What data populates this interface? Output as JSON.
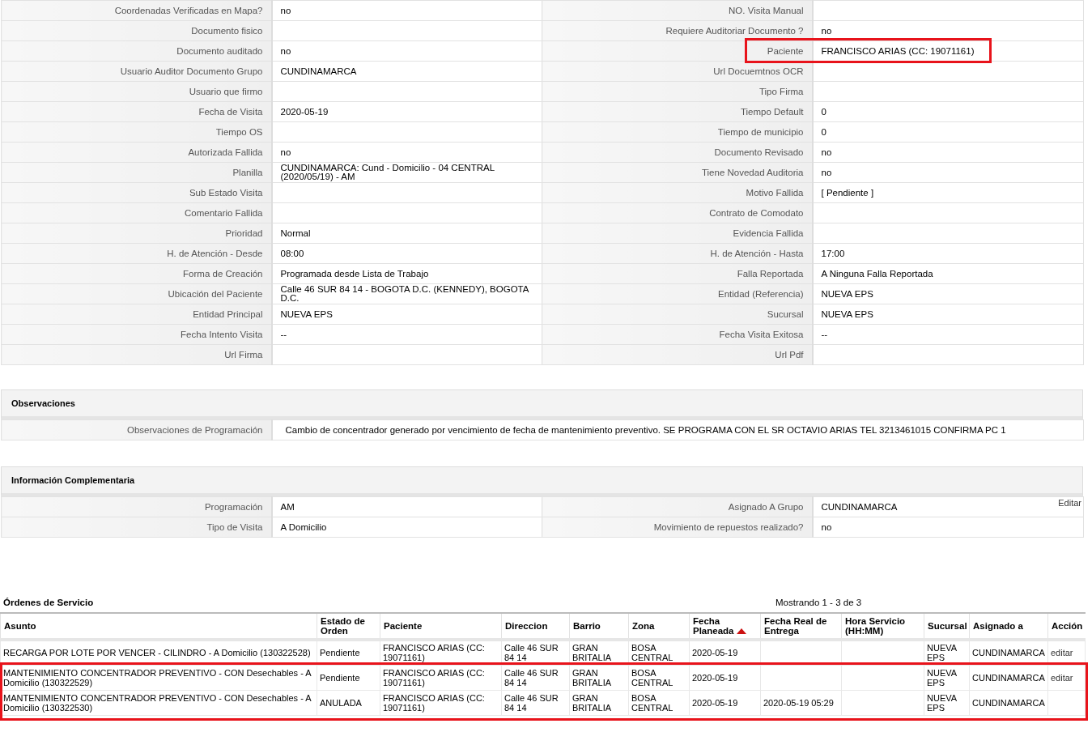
{
  "details": [
    {
      "left": {
        "label": "Coordenadas Verificadas en Mapa?",
        "value": "no"
      },
      "right": {
        "label": "NO. Visita Manual"
      }
    },
    {
      "left": {
        "label": "Documento fisico"
      },
      "right": {
        "label": "Requiere Auditoriar Documento ?",
        "value": "no"
      }
    },
    {
      "left": {
        "label": "Documento auditado",
        "value": "no"
      },
      "right": {
        "label": "Paciente",
        "value": "FRANCISCO ARIAS (CC: 19071161)",
        "highlighted": true
      }
    },
    {
      "left": {
        "label": "Usuario Auditor Documento Grupo",
        "value": "CUNDINAMARCA"
      },
      "right": {
        "label": "Url Docuemtnos OCR"
      }
    },
    {
      "left": {
        "label": "Usuario que firmo"
      },
      "right": {
        "label": "Tipo Firma"
      }
    },
    {
      "left": {
        "label": "Fecha de Visita",
        "value": "2020-05-19"
      },
      "right": {
        "label": "Tiempo Default",
        "value": "0"
      }
    },
    {
      "left": {
        "label": "Tiempo OS"
      },
      "right": {
        "label": "Tiempo de municipio",
        "value": "0"
      }
    },
    {
      "left": {
        "label": "Autorizada Fallida",
        "value": "no"
      },
      "right": {
        "label": "Documento Revisado",
        "value": "no"
      }
    },
    {
      "left": {
        "label": "Planilla",
        "value": "CUNDINAMARCA: Cund - Domicilio - 04 CENTRAL (2020/05/19) - AM"
      },
      "right": {
        "label": "Tiene Novedad Auditoria",
        "value": "no"
      }
    },
    {
      "left": {
        "label": "Sub Estado Visita"
      },
      "right": {
        "label": "Motivo Fallida",
        "value": "[ Pendiente ]"
      }
    },
    {
      "left": {
        "label": "Comentario Fallida"
      },
      "right": {
        "label": "Contrato de Comodato"
      }
    },
    {
      "left": {
        "label": "Prioridad",
        "value": "Normal"
      },
      "right": {
        "label": "Evidencia Fallida"
      }
    },
    {
      "left": {
        "label": "H. de Atención - Desde",
        "value": "08:00"
      },
      "right": {
        "label": "H. de Atención - Hasta",
        "value": "17:00"
      }
    },
    {
      "left": {
        "label": "Forma de Creación",
        "value": "Programada desde Lista de Trabajo"
      },
      "right": {
        "label": "Falla Reportada",
        "value": "A Ninguna Falla Reportada"
      }
    },
    {
      "left": {
        "label": "Ubicación del Paciente",
        "value": "Calle 46 SUR 84 14 - BOGOTA D.C. (KENNEDY), BOGOTA D.C."
      },
      "right": {
        "label": "Entidad (Referencia)",
        "value": "NUEVA EPS"
      }
    },
    {
      "left": {
        "label": "Entidad Principal",
        "value": "NUEVA EPS"
      },
      "right": {
        "label": "Sucursal",
        "value": "NUEVA EPS"
      }
    },
    {
      "left": {
        "label": "Fecha Intento Visita",
        "value": "--"
      },
      "right": {
        "label": "Fecha Visita Exitosa",
        "value": "--"
      }
    },
    {
      "left": {
        "label": "Url Firma"
      },
      "right": {
        "label": "Url Pdf"
      }
    }
  ],
  "observaciones": {
    "title": "Observaciones",
    "label": "Observaciones de Programación",
    "value": "Cambio de concentrador generado por vencimiento de fecha de mantenimiento preventivo. SE PROGRAMA CON EL SR OCTAVIO ARIAS TEL 3213461015 CONFIRMA PC 1"
  },
  "informacion": {
    "title": "Información Complementaria",
    "rows": [
      {
        "left": {
          "label": "Programación",
          "value": "AM"
        },
        "right": {
          "label": "Asignado A Grupo",
          "value": "CUNDINAMARCA",
          "edit_link": "Editar"
        }
      },
      {
        "left": {
          "label": "Tipo de Visita",
          "value": "A Domicilio"
        },
        "right": {
          "label": "Movimiento de repuestos realizado?",
          "value": "no"
        }
      }
    ]
  },
  "ordenes": {
    "title": "Órdenes de Servicio",
    "pagination": "Mostrando 1 - 3 de 3",
    "columns": [
      {
        "label": "Asunto",
        "sorted": false
      },
      {
        "label": "Estado de Orden",
        "sorted": false
      },
      {
        "label": "Paciente",
        "sorted": false
      },
      {
        "label": "Direccion",
        "sorted": false
      },
      {
        "label": "Barrio",
        "sorted": false
      },
      {
        "label": "Zona",
        "sorted": false
      },
      {
        "label": "Fecha Planeada",
        "sorted": true
      },
      {
        "label": "Fecha Real de Entrega",
        "sorted": false
      },
      {
        "label": "Hora Servicio (HH:MM)",
        "sorted": false
      },
      {
        "label": "Sucursal",
        "sorted": false
      },
      {
        "label": "Asignado a",
        "sorted": false
      },
      {
        "label": "Acción",
        "sorted": false
      }
    ],
    "rows": [
      {
        "highlighted": false,
        "cells": [
          "RECARGA POR LOTE POR VENCER - CILINDRO - A Domicilio (130322528)",
          "Pendiente",
          "FRANCISCO ARIAS (CC: 19071161)",
          "Calle 46 SUR 84 14",
          "GRAN BRITALIA",
          "BOSA CENTRAL",
          "2020-05-19",
          null,
          null,
          "NUEVA EPS",
          "CUNDINAMARCA",
          "editar"
        ]
      },
      {
        "highlighted": true,
        "cells": [
          "MANTENIMIENTO CONCENTRADOR PREVENTIVO - CON Desechables - A Domicilio (130322529)",
          "Pendiente",
          "FRANCISCO ARIAS (CC: 19071161)",
          "Calle 46 SUR 84 14",
          "GRAN BRITALIA",
          "BOSA CENTRAL",
          "2020-05-19",
          null,
          null,
          "NUEVA EPS",
          "CUNDINAMARCA",
          "editar"
        ]
      },
      {
        "highlighted": true,
        "cells": [
          "MANTENIMIENTO CONCENTRADOR PREVENTIVO - CON Desechables - A Domicilio (130322530)",
          "ANULADA",
          "FRANCISCO ARIAS (CC: 19071161)",
          "Calle 46 SUR 84 14",
          "GRAN BRITALIA",
          "BOSA CENTRAL",
          "2020-05-19",
          "2020-05-19 05:29",
          null,
          "NUEVA EPS",
          "CUNDINAMARCA",
          null
        ]
      }
    ]
  }
}
